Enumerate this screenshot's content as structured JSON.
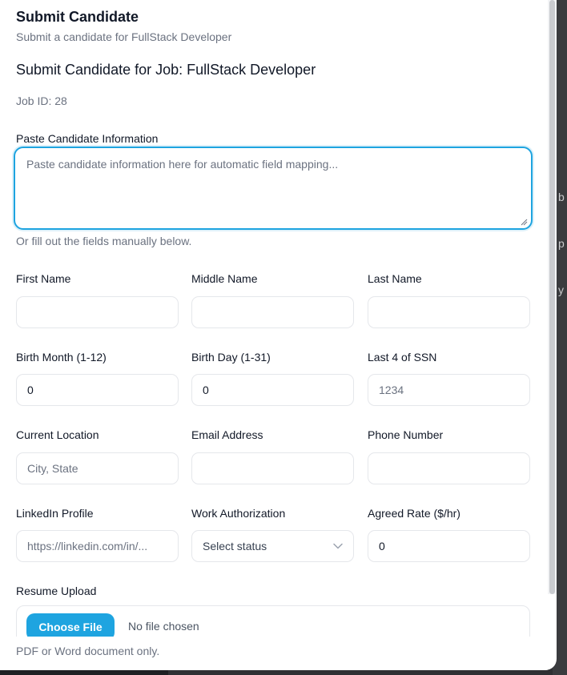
{
  "modal": {
    "title": "Submit Candidate",
    "subtitle": "Submit a candidate for FullStack Developer"
  },
  "form": {
    "title": "Submit Candidate for Job: FullStack Developer",
    "job_id": "Job ID: 28",
    "paste": {
      "label": "Paste Candidate Information",
      "placeholder": "Paste candidate information here for automatic field mapping..."
    },
    "manual_hint": "Or fill out the fields manually below.",
    "fields": {
      "first_name": {
        "label": "First Name",
        "value": "",
        "placeholder": ""
      },
      "middle_name": {
        "label": "Middle Name",
        "value": "",
        "placeholder": ""
      },
      "last_name": {
        "label": "Last Name",
        "value": "",
        "placeholder": ""
      },
      "birth_month": {
        "label": "Birth Month (1-12)",
        "value": "0"
      },
      "birth_day": {
        "label": "Birth Day (1-31)",
        "value": "0"
      },
      "ssn_last4": {
        "label": "Last 4 of SSN",
        "value": "",
        "placeholder": "1234"
      },
      "current_location": {
        "label": "Current Location",
        "value": "",
        "placeholder": "City, State"
      },
      "email": {
        "label": "Email Address",
        "value": "",
        "placeholder": ""
      },
      "phone": {
        "label": "Phone Number",
        "value": "",
        "placeholder": ""
      },
      "linkedin": {
        "label": "LinkedIn Profile",
        "value": "",
        "placeholder": "https://linkedin.com/in/..."
      },
      "work_auth": {
        "label": "Work Authorization",
        "selected": "Select status"
      },
      "agreed_rate": {
        "label": "Agreed Rate ($/hr)",
        "value": "0"
      }
    },
    "resume": {
      "label": "Resume Upload",
      "button": "Choose File",
      "status": "No file chosen",
      "hint": "PDF or Word document only."
    }
  },
  "background_fragments": [
    "b",
    "p",
    "y"
  ],
  "colors": {
    "accent": "#1ea4e0",
    "text": "#111827",
    "muted": "#6b7280",
    "border": "#e5e7eb",
    "overlay": "#2f3033"
  }
}
